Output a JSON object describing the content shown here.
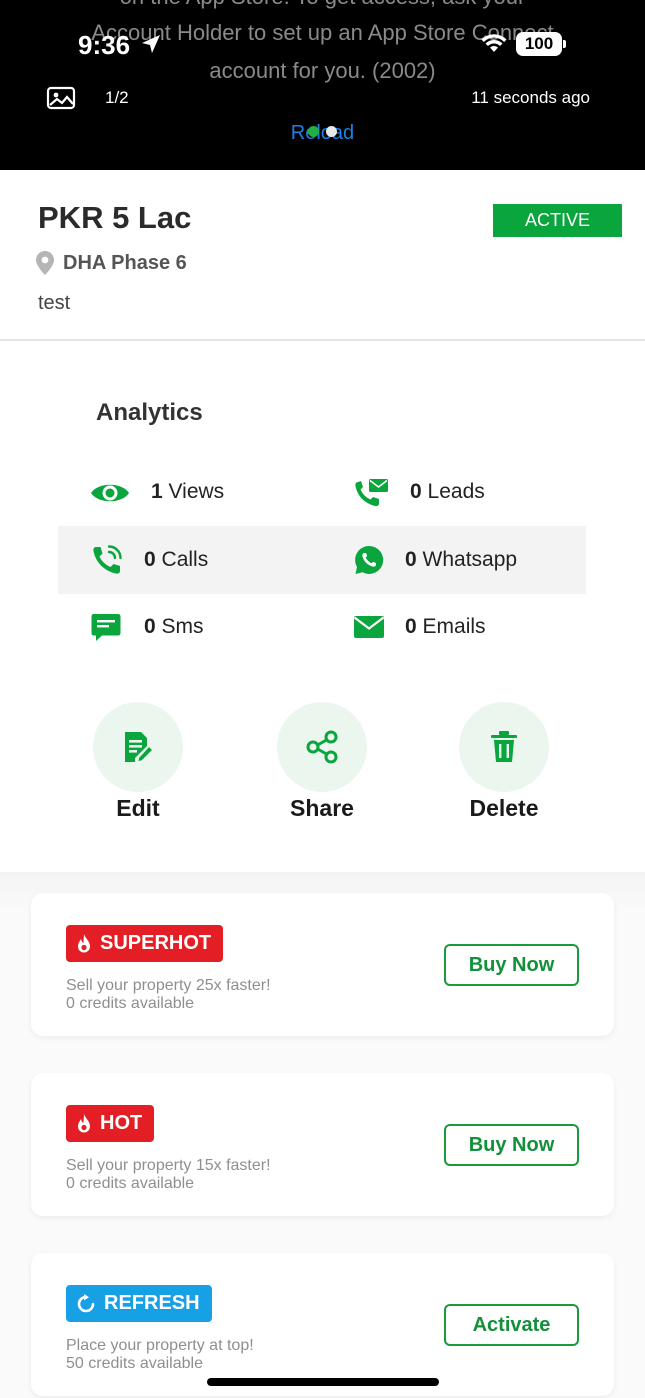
{
  "overlay": {
    "message_lines": [
      "on the App Store. To get access, ask your",
      "Account Holder to set up an App Store Connect",
      "account for you. (2002)"
    ],
    "page_indicator": "1/2",
    "time_ago": "11 seconds ago",
    "reload_label": "Reload"
  },
  "status_bar": {
    "time": "9:36",
    "battery": "100"
  },
  "listing": {
    "price": "PKR 5 Lac",
    "status": "ACTIVE",
    "location": "DHA Phase 6",
    "description": "test"
  },
  "analytics": {
    "title": "Analytics",
    "stats": [
      {
        "count": "1",
        "label": "Views",
        "icon": "eye-icon"
      },
      {
        "count": "0",
        "label": "Leads",
        "icon": "phone-mail-icon"
      },
      {
        "count": "0",
        "label": "Calls",
        "icon": "phone-ringing-icon"
      },
      {
        "count": "0",
        "label": "Whatsapp",
        "icon": "whatsapp-icon"
      },
      {
        "count": "0",
        "label": "Sms",
        "icon": "message-icon"
      },
      {
        "count": "0",
        "label": "Emails",
        "icon": "envelope-icon"
      }
    ]
  },
  "actions": [
    {
      "label": "Edit",
      "icon": "edit-document-icon"
    },
    {
      "label": "Share",
      "icon": "share-icon"
    },
    {
      "label": "Delete",
      "icon": "trash-icon"
    }
  ],
  "boosts": [
    {
      "badge": "SUPERHOT",
      "line1": "Sell your property 25x faster!",
      "line2": "0 credits available",
      "button": "Buy Now",
      "color": "#e31e24"
    },
    {
      "badge": "HOT",
      "line1": "Sell your property 15x faster!",
      "line2": "0 credits available",
      "button": "Buy Now",
      "color": "#e31e24"
    },
    {
      "badge": "REFRESH",
      "line1": "Place your property at top!",
      "line2": "50 credits available",
      "button": "Activate",
      "color": "#18a0e4"
    }
  ],
  "colors": {
    "primary_green": "#0aa53d",
    "hot_red": "#e31e24",
    "refresh_blue": "#18a0e4"
  }
}
